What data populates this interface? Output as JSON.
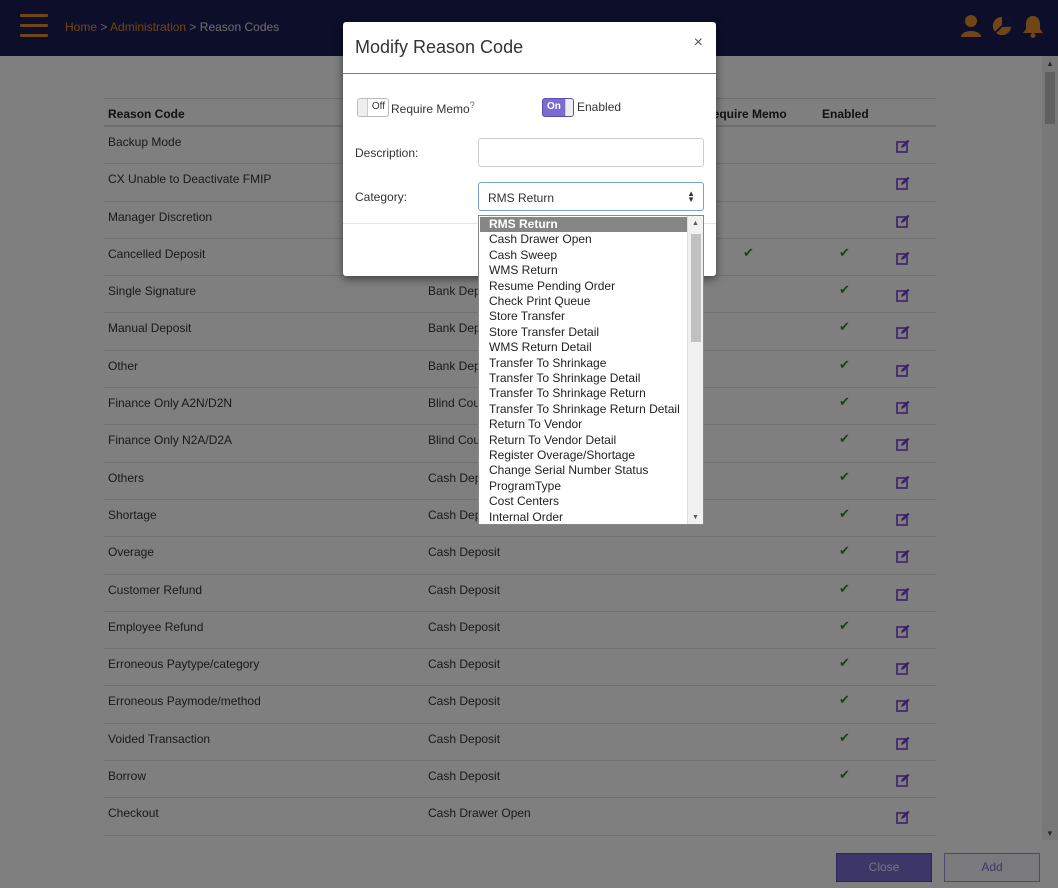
{
  "breadcrumb": {
    "home": "Home",
    "sep": ">",
    "admin": "Administration",
    "current": "Reason Codes"
  },
  "table": {
    "headers": {
      "reason_code": "Reason Code",
      "require_memo": "Require Memo",
      "enabled": "Enabled"
    },
    "rows": [
      {
        "code": "Backup Mode",
        "category": "",
        "memo": "",
        "enabled": ""
      },
      {
        "code": "CX Unable to Deactivate FMIP",
        "category": "",
        "memo": "",
        "enabled": ""
      },
      {
        "code": "Manager Discretion",
        "category": "",
        "memo": "",
        "enabled": ""
      },
      {
        "code": "Cancelled Deposit",
        "category": "",
        "memo": "✔",
        "enabled": "✔"
      },
      {
        "code": "Single Signature",
        "category": "Bank Dep",
        "memo": "",
        "enabled": "✔"
      },
      {
        "code": "Manual Deposit",
        "category": "Bank Dep",
        "memo": "",
        "enabled": "✔"
      },
      {
        "code": "Other",
        "category": "Bank Dep",
        "memo": "",
        "enabled": "✔"
      },
      {
        "code": "Finance Only A2N/D2N",
        "category": "Blind Cou",
        "memo": "",
        "enabled": "✔"
      },
      {
        "code": "Finance Only N2A/D2A",
        "category": "Blind Cou",
        "memo": "",
        "enabled": "✔"
      },
      {
        "code": "Others",
        "category": "Cash Dep",
        "memo": "",
        "enabled": "✔"
      },
      {
        "code": "Shortage",
        "category": "Cash Dep",
        "memo": "",
        "enabled": "✔"
      },
      {
        "code": "Overage",
        "category": "Cash Deposit",
        "memo": "",
        "enabled": "✔"
      },
      {
        "code": "Customer Refund",
        "category": "Cash Deposit",
        "memo": "",
        "enabled": "✔"
      },
      {
        "code": "Employee Refund",
        "category": "Cash Deposit",
        "memo": "",
        "enabled": "✔"
      },
      {
        "code": "Erroneous Paytype/category",
        "category": "Cash Deposit",
        "memo": "",
        "enabled": "✔"
      },
      {
        "code": "Erroneous Paymode/method",
        "category": "Cash Deposit",
        "memo": "",
        "enabled": "✔"
      },
      {
        "code": "Voided Transaction",
        "category": "Cash Deposit",
        "memo": "",
        "enabled": "✔"
      },
      {
        "code": "Borrow",
        "category": "Cash Deposit",
        "memo": "",
        "enabled": "✔"
      },
      {
        "code": "Checkout",
        "category": "Cash Drawer Open",
        "memo": "",
        "enabled": ""
      }
    ]
  },
  "footer": {
    "close": "Close",
    "add": "Add"
  },
  "modal": {
    "title": "Modify Reason Code",
    "close": "×",
    "memo_toggle": {
      "state": "Off",
      "label": "Require Memo",
      "help": "?"
    },
    "enabled_toggle": {
      "state": "On",
      "label": "Enabled"
    },
    "description_label": "Description:",
    "description_value": "",
    "category_label": "Category:",
    "category_value": "RMS Return"
  },
  "dropdown": {
    "options": [
      "RMS Return",
      "Cash Drawer Open",
      "Cash Sweep",
      "WMS Return",
      "Resume Pending Order",
      "Check Print Queue",
      "Store Transfer",
      "Store Transfer Detail",
      "WMS Return Detail",
      "Transfer To Shrinkage",
      "Transfer To Shrinkage Detail",
      "Transfer To Shrinkage Return",
      "Transfer To Shrinkage Return Detail",
      "Return To Vendor",
      "Return To Vendor Detail",
      "Register Overage/Shortage",
      "Change Serial Number Status",
      "ProgramType",
      "Cost Centers",
      "Internal Order"
    ],
    "selected": "RMS Return"
  },
  "colors": {
    "header_bg": "#1b1c52",
    "accent": "#e58a2c",
    "primary": "#7b6cd0",
    "check": "#2e8b2e"
  }
}
